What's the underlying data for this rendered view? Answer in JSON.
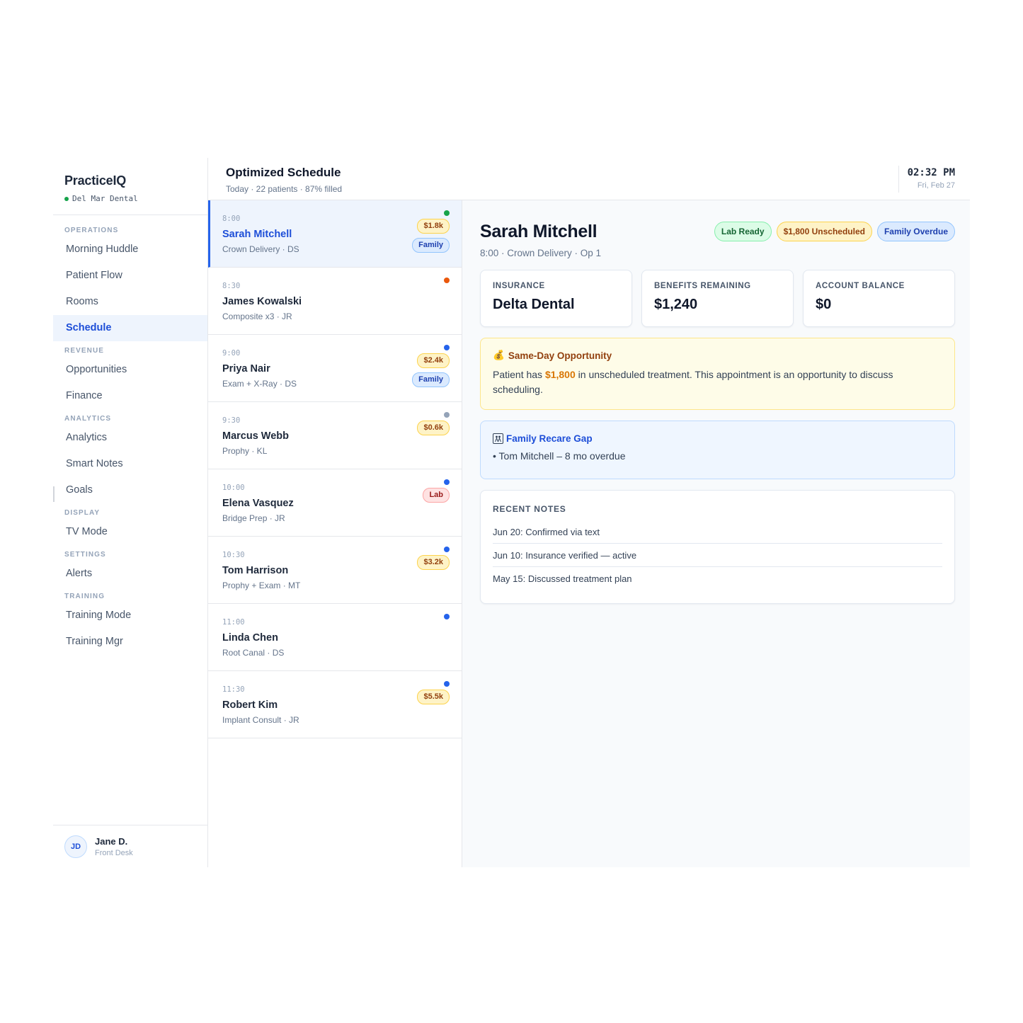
{
  "brand": {
    "name": "PracticeIQ",
    "practice": "Del Mar Dental"
  },
  "nav": [
    {
      "section": "OPERATIONS",
      "items": [
        {
          "label": "Morning Huddle",
          "id": "morning-huddle"
        },
        {
          "label": "Patient Flow",
          "id": "patient-flow"
        },
        {
          "label": "Rooms",
          "id": "rooms"
        },
        {
          "label": "Schedule",
          "id": "schedule",
          "active": true
        }
      ]
    },
    {
      "section": "REVENUE",
      "items": [
        {
          "label": "Opportunities",
          "id": "opportunities"
        },
        {
          "label": "Finance",
          "id": "finance"
        }
      ]
    },
    {
      "section": "ANALYTICS",
      "items": [
        {
          "label": "Analytics",
          "id": "analytics"
        },
        {
          "label": "Smart Notes",
          "id": "smart-notes"
        },
        {
          "label": "Goals",
          "id": "goals"
        }
      ]
    },
    {
      "section": "DISPLAY",
      "items": [
        {
          "label": "TV Mode",
          "id": "tv-mode"
        }
      ]
    },
    {
      "section": "SETTINGS",
      "items": [
        {
          "label": "Alerts",
          "id": "alerts"
        }
      ]
    },
    {
      "section": "TRAINING",
      "items": [
        {
          "label": "Training Mode",
          "id": "training-mode"
        },
        {
          "label": "Training Mgr",
          "id": "training-mgr"
        }
      ]
    }
  ],
  "user": {
    "initials": "JD",
    "name": "Jane D.",
    "role": "Front Desk"
  },
  "header": {
    "title": "Optimized Schedule",
    "subtitle": "Today · 22 patients · 87% filled",
    "time": "02:32 PM",
    "date": "Fri, Feb 27"
  },
  "appointments": [
    {
      "time": "8:00",
      "name": "Sarah Mitchell",
      "detail": "Crown Delivery · DS",
      "dot": "#16a34a",
      "badges": [
        {
          "text": "$1.8k",
          "kind": "amount"
        },
        {
          "text": "Family",
          "kind": "family"
        }
      ],
      "selected": true
    },
    {
      "time": "8:30",
      "name": "James Kowalski",
      "detail": "Composite x3 · JR",
      "dot": "#ea580c",
      "badges": []
    },
    {
      "time": "9:00",
      "name": "Priya Nair",
      "detail": "Exam + X-Ray · DS",
      "dot": "#2563eb",
      "badges": [
        {
          "text": "$2.4k",
          "kind": "amount"
        },
        {
          "text": "Family",
          "kind": "family"
        }
      ]
    },
    {
      "time": "9:30",
      "name": "Marcus Webb",
      "detail": "Prophy · KL",
      "dot": "#94a3b8",
      "badges": [
        {
          "text": "$0.6k",
          "kind": "amount"
        }
      ]
    },
    {
      "time": "10:00",
      "name": "Elena Vasquez",
      "detail": "Bridge Prep · JR",
      "dot": "#2563eb",
      "badges": [
        {
          "text": "Lab",
          "kind": "lab"
        }
      ]
    },
    {
      "time": "10:30",
      "name": "Tom Harrison",
      "detail": "Prophy + Exam · MT",
      "dot": "#2563eb",
      "badges": [
        {
          "text": "$3.2k",
          "kind": "amount"
        }
      ]
    },
    {
      "time": "11:00",
      "name": "Linda Chen",
      "detail": "Root Canal · DS",
      "dot": "#2563eb",
      "badges": []
    },
    {
      "time": "11:30",
      "name": "Robert Kim",
      "detail": "Implant Consult · JR",
      "dot": "#2563eb",
      "badges": [
        {
          "text": "$5.5k",
          "kind": "amount"
        }
      ]
    }
  ],
  "detail": {
    "name": "Sarah Mitchell",
    "subtitle": "8:00 · Crown Delivery · Op 1",
    "tags": [
      {
        "text": "Lab Ready",
        "kind": "green"
      },
      {
        "text": "$1,800 Unscheduled",
        "kind": "amber"
      },
      {
        "text": "Family Overdue",
        "kind": "blue"
      }
    ],
    "cards": [
      {
        "label": "INSURANCE",
        "value": "Delta Dental"
      },
      {
        "label": "BENEFITS REMAINING",
        "value": "$1,240"
      },
      {
        "label": "ACCOUNT BALANCE",
        "value": "$0"
      }
    ],
    "opportunity": {
      "icon": "💰",
      "title": "Same-Day Opportunity",
      "text_before": "Patient has ",
      "amount": "$1,800",
      "text_after": " in unscheduled treatment. This appointment is an opportunity to discuss scheduling."
    },
    "recare": {
      "title": "Family Recare Gap",
      "items": [
        "• Tom Mitchell – 8 mo overdue"
      ]
    },
    "notes": {
      "title": "RECENT NOTES",
      "items": [
        "Jun 20: Confirmed via text",
        "Jun 10: Insurance verified — active",
        "May 15: Discussed treatment plan"
      ]
    }
  }
}
